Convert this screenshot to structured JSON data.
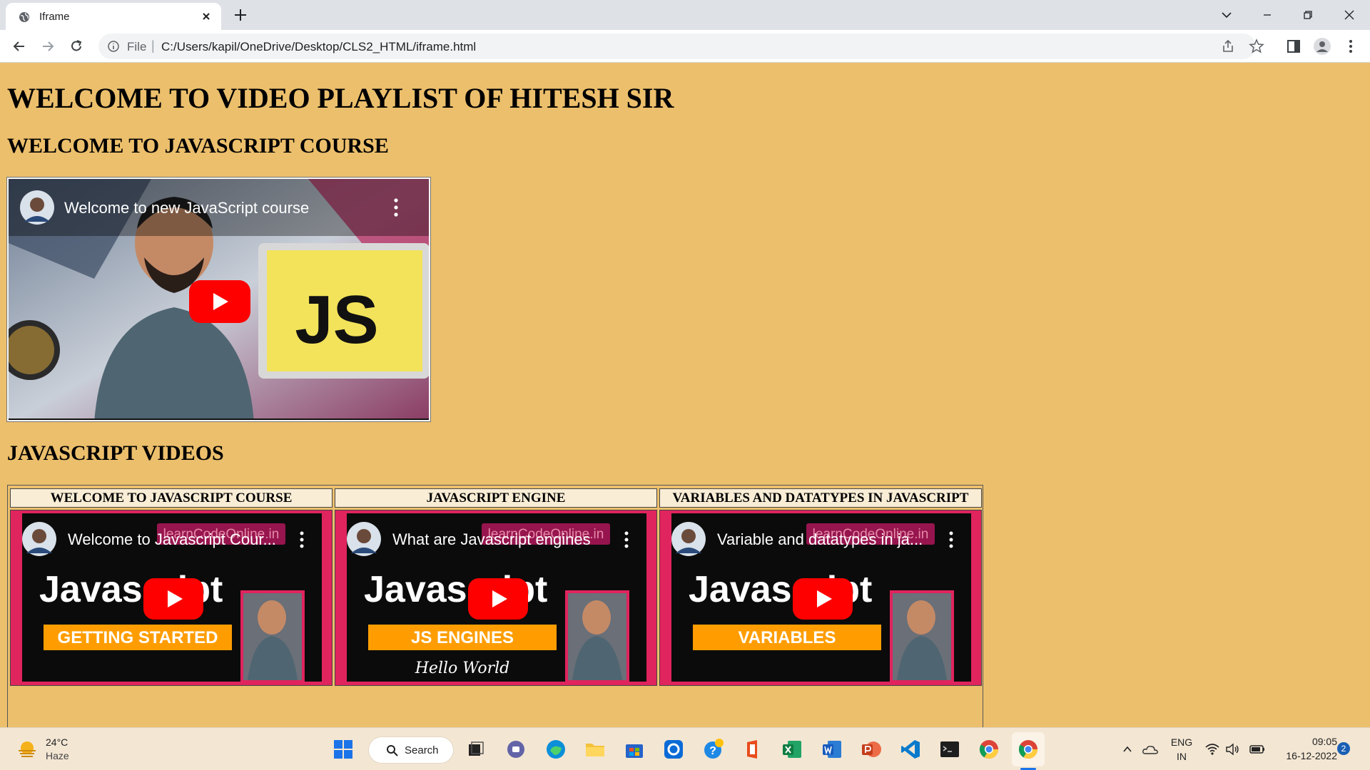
{
  "browser": {
    "tab_title": "Iframe",
    "address_scheme": "File",
    "address_separator": "|",
    "url": "C:/Users/kapil/OneDrive/Desktop/CLS2_HTML/iframe.html"
  },
  "page": {
    "heading_main": "WELCOME TO VIDEO PLAYLIST OF HITESH SIR",
    "heading_course": "WELCOME TO JAVASCRIPT COURSE",
    "heading_videos": "JAVASCRIPT VIDEOS",
    "main_video": {
      "title": "Welcome to new JavaScript course",
      "thumb_text": "JS"
    },
    "table": [
      {
        "header": "WELCOME TO JAVASCRIPT COURSE",
        "video_title": "Welcome to Javascript Cour...",
        "watermark": "learnCodeOnline.in",
        "big_text": "Javascript",
        "banner": "GETTING STARTED",
        "extra": ""
      },
      {
        "header": "JAVASCRIPT ENGINE",
        "video_title": "What are Javascript engines",
        "watermark": "learnCodeOnline.in",
        "big_text": "Javascript",
        "banner": "JS ENGINES",
        "extra": "Hello World"
      },
      {
        "header": "VARIABLES AND DATATYPES IN JAVASCRIPT",
        "video_title": "Variable and datatypes in ja...",
        "watermark": "learnCodeOnline.in",
        "big_text": "Javascript",
        "banner": "VARIABLES",
        "extra": ""
      }
    ]
  },
  "taskbar": {
    "weather_temp": "24°C",
    "weather_desc": "Haze",
    "search_label": "Search",
    "lang_line1": "ENG",
    "lang_line2": "IN",
    "time": "09:05",
    "date": "16-12-2022",
    "notification_count": "2"
  },
  "colors": {
    "page_bg": "#ecbf6c",
    "youtube_red": "#ff0000",
    "banner_orange": "#ff9d00"
  }
}
